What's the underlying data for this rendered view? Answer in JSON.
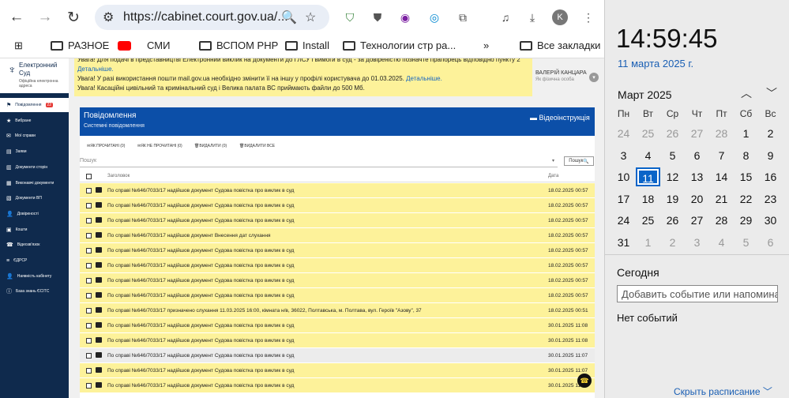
{
  "browser": {
    "url": "https://cabinet.court.gov.ua/...",
    "profile_initial": "K",
    "bookmarks": [
      "РАЗНОЕ",
      "СМИ",
      "ВСПОМ PHP",
      "Install",
      "Технологии стр ра...",
      "Все закладки"
    ]
  },
  "site": {
    "logo": {
      "line1": "Електронний",
      "line2": "Суд",
      "line3": "Офіційна електронна адреса"
    },
    "nav": [
      {
        "label": "Повідомлення",
        "badge": "22"
      },
      {
        "label": "Вибране"
      },
      {
        "label": "Мої справи"
      },
      {
        "label": "Заяви"
      },
      {
        "label": "Документи сторін"
      },
      {
        "label": "Виконавчі документи"
      },
      {
        "label": "Документи ВП"
      },
      {
        "label": "Довіреності"
      },
      {
        "label": "Кошти"
      },
      {
        "label": "Відеозв'язок"
      },
      {
        "label": "ЄДРСР"
      },
      {
        "label": "Наявність кабінету"
      },
      {
        "label": "База знань ЄСІТС"
      }
    ],
    "notice": {
      "line0": "Увага! Для подачі в представництві Електронний виклик на документи до ГЛСУ і вимоги в суд - за довіреністю позначте прапорець відповідно пункту 2",
      "line1_link": "Детальніше.",
      "line2": "Увага! У разі використання пошти mail.gov.ua необхідно змінити її на іншу у профілі користувача до 01.03.2025.",
      "line2_link": "Детальніше.",
      "line3": "Увага! Касаційні цивільний та кримінальний суд і Велика палата ВС приймають файли до 500 Мб."
    },
    "user": {
      "name": "ВАЛЕРІЙ КАНЦАРА",
      "role": "Як фізична особа"
    },
    "panel": {
      "title": "Повідомлення",
      "subtitle": "Системні повідомлення",
      "video": "Відеоінструкція",
      "actions": [
        "ЯК ПРОЧИТАНІ (0)",
        "ЯК НЕ ПРОЧИТАНІ (0)",
        "ВИДАЛИТИ (0)",
        "ВИДАЛИТИ ВСЕ"
      ],
      "search_placeholder": "Пошук",
      "search_button": "Пошук",
      "col_subject": "Заголовок",
      "col_date": "Дата"
    },
    "rows": [
      {
        "s": "По справі №646/7033/17 надійшов документ Судова повістка про виклик в суд",
        "d": "18.02.2025 00:57"
      },
      {
        "s": "По справі №646/7033/17 надійшов документ Судова повістка про виклик в суд",
        "d": "18.02.2025 00:57"
      },
      {
        "s": "По справі №646/7033/17 надійшов документ Судова повістка про виклик в суд",
        "d": "18.02.2025 00:57"
      },
      {
        "s": "По справі №646/7033/17 надійшов документ Внесення дат слухання",
        "d": "18.02.2025 00:57"
      },
      {
        "s": "По справі №646/7033/17 надійшов документ Судова повістка про виклик в суд",
        "d": "18.02.2025 00:57"
      },
      {
        "s": "По справі №646/7033/17 надійшов документ Судова повістка про виклик в суд",
        "d": "18.02.2025 00:57"
      },
      {
        "s": "По справі №646/7033/17 надійшов документ Судова повістка про виклик в суд",
        "d": "18.02.2025 00:57"
      },
      {
        "s": "По справі №646/7033/17 надійшов документ Судова повістка про виклик в суд",
        "d": "18.02.2025 00:57"
      },
      {
        "s": "По справі №646/7033/17 призначено слухання 11.03.2025 16:00, кімната н/в, 36022, Полтавська, м. Полтава, вул. Героїв \"Азову\", 37",
        "d": "18.02.2025 00:51"
      },
      {
        "s": "По справі №646/7033/17 надійшов документ Судова повістка про виклик в суд",
        "d": "30.01.2025 11:08"
      },
      {
        "s": "По справі №646/7033/17 надійшов документ Судова повістка про виклик в суд",
        "d": "30.01.2025 11:08"
      },
      {
        "s": "По справі №646/7033/17 надійшов документ Судова повістка про виклик в суд",
        "d": "30.01.2025 11:07",
        "grey": true
      },
      {
        "s": "По справі №646/7033/17 надійшов документ Судова повістка про виклик в суд",
        "d": "30.01.2025 11:07"
      },
      {
        "s": "По справі №646/7033/17 надійшов документ Судова повістка про виклик в суд",
        "d": "30.01.2025 11:07"
      }
    ]
  },
  "calendar": {
    "time": "14:59:45",
    "date": "11 марта 2025 г.",
    "month": "Март 2025",
    "weekdays": [
      "Пн",
      "Вт",
      "Ср",
      "Чт",
      "Пт",
      "Сб",
      "Вс"
    ],
    "days": [
      [
        "24",
        "25",
        "26",
        "27",
        "28",
        "1",
        "2"
      ],
      [
        "3",
        "4",
        "5",
        "6",
        "7",
        "8",
        "9"
      ],
      [
        "10",
        "11",
        "12",
        "13",
        "14",
        "15",
        "16"
      ],
      [
        "17",
        "18",
        "19",
        "20",
        "21",
        "22",
        "23"
      ],
      [
        "24",
        "25",
        "26",
        "27",
        "28",
        "29",
        "30"
      ],
      [
        "31",
        "1",
        "2",
        "3",
        "4",
        "5",
        "6"
      ]
    ],
    "today_label": "Сегодня",
    "add_placeholder": "Добавить событие или напомина",
    "no_events": "Нет событий",
    "hide": "Скрыть расписание"
  }
}
